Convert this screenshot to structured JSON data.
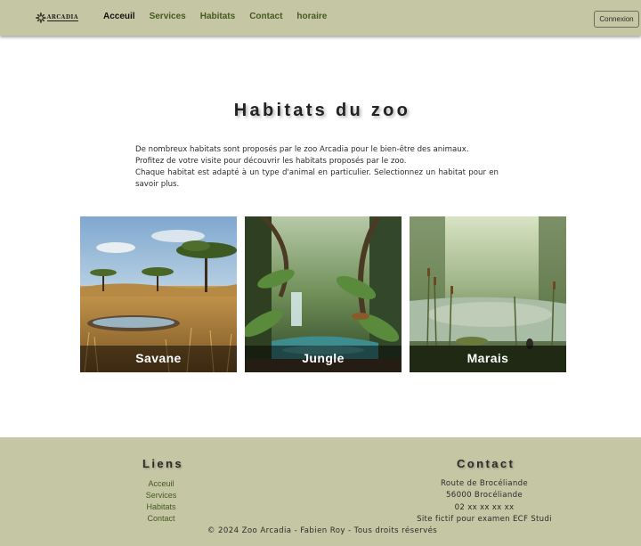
{
  "navbar": {
    "logo_text": "ARCADIA",
    "links": [
      {
        "label": "Acceuil",
        "active": true
      },
      {
        "label": "Services",
        "active": false
      },
      {
        "label": "Habitats",
        "active": false
      },
      {
        "label": "Contact",
        "active": false
      },
      {
        "label": "horaire",
        "active": false
      }
    ],
    "login_label": "Connexion"
  },
  "main": {
    "title": "Habitats du zoo",
    "intro": [
      "De nombreux habitats sont proposés par le zoo Arcadia pour le bien-être des animaux.",
      "Profitez de votre visite pour découvrir les habitats proposés par le zoo.",
      "Chaque habitat est adapté à un type d'animal en particulier. Selectionnez un habitat pour en savoir plus."
    ],
    "habitats": [
      {
        "name": "Savane",
        "image": "savanna-image"
      },
      {
        "name": "Jungle",
        "image": "jungle-image"
      },
      {
        "name": "Marais",
        "image": "marsh-image"
      }
    ]
  },
  "footer": {
    "links_title": "Liens",
    "links": [
      "Acceuil",
      "Services",
      "Habitats",
      "Contact"
    ],
    "contact_title": "Contact",
    "contact_lines": [
      "Route de Brocéliande",
      "56000 Brocéliande",
      "02 xx xx xx xx",
      "Site fictif pour examen ECF Studi"
    ],
    "copyright": "© 2024 Zoo Arcadia - Fabien Roy - Tous droits réservés"
  },
  "colors": {
    "navbar_bg": "#c5c6a4",
    "footer_bg": "#c5c6a4",
    "link_green": "#445a1e"
  }
}
